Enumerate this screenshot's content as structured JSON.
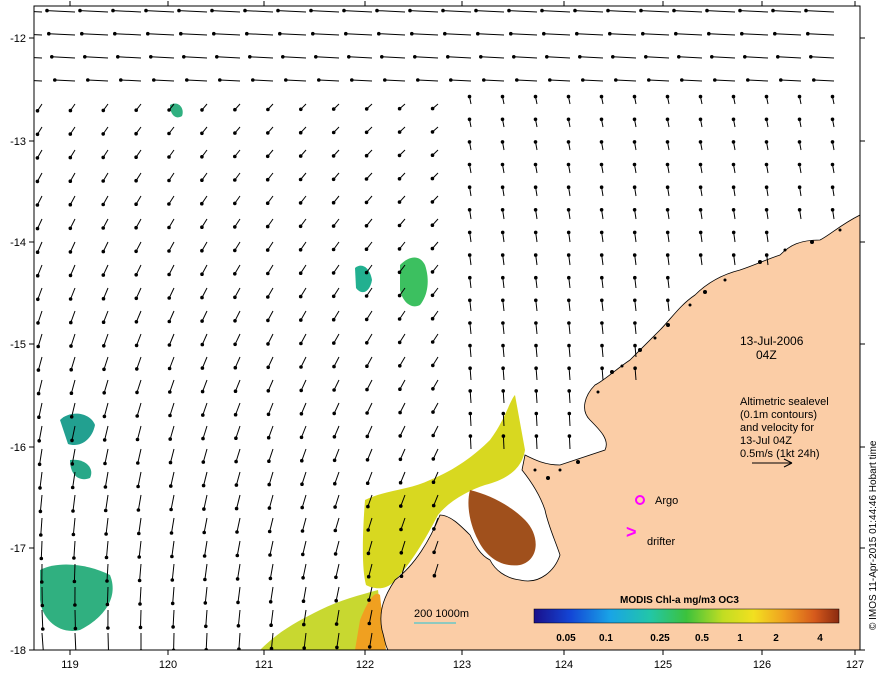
{
  "map": {
    "lon_ticks": [
      "119",
      "120",
      "121",
      "122",
      "123",
      "124",
      "125",
      "126",
      "127"
    ],
    "lat_ticks": [
      "-12",
      "-13",
      "-14",
      "-15",
      "-16",
      "-17",
      "-18"
    ],
    "date_label": "13-Jul-2006",
    "time_label": "04Z",
    "legend_lines": [
      "Altimetric sealevel",
      "(0.1m contours)",
      "and velocity for",
      "13-Jul 04Z",
      "0.5m/s (1kt 24h)"
    ],
    "argo_label": "Argo",
    "drifter_label": "drifter",
    "drifter_symbol": ">",
    "bathy_label": "200  1000m",
    "colorbar_title": "MODIS Chl-a mg/m3 OC3",
    "colorbar_ticks": [
      "0.05",
      "0.1",
      "0.25",
      "0.5",
      "1",
      "2",
      "4"
    ],
    "credit": "© IMOS 11-Apr-2015 01:44:46 Hobart time",
    "colors": {
      "land": "#fbcda6",
      "coast": "#000000",
      "bathy_contour": "#22c5d8",
      "argo_marker": "#ff00ff",
      "drifter_marker": "#ff00ff"
    }
  }
}
